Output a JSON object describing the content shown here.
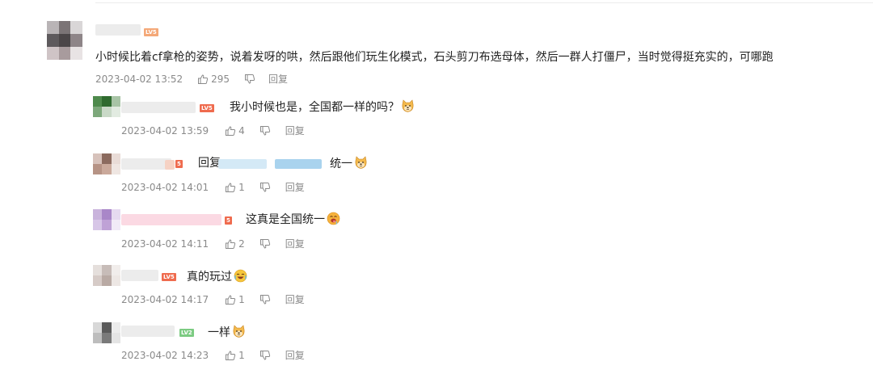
{
  "main_comment": {
    "level_badge": "LV5",
    "text": "小时候比着cf拿枪的姿势，说着发呀的哄，然后跟他们玩生化模式，石头剪刀布选母体，然后一群人打僵尸，当时觉得挺充实的，可哪跑",
    "timestamp": "2023-04-02 13:52",
    "likes": "295",
    "reply_label": "回复"
  },
  "replies": [
    {
      "level_badge": "LV5",
      "text": "我小时候也是，全国都一样的吗？",
      "emoji": "doge-emoji",
      "timestamp": "2023-04-02 13:59",
      "likes": "4",
      "reply_label": "回复"
    },
    {
      "level_badge": "5",
      "prefix": "回复",
      "text": "统一",
      "emoji": "doge-emoji",
      "timestamp": "2023-04-02 14:01",
      "likes": "1",
      "reply_label": "回复"
    },
    {
      "level_badge": "5",
      "text": "这真是全国统一",
      "emoji": "drool-emoji",
      "timestamp": "2023-04-02 14:11",
      "likes": "2",
      "reply_label": "回复"
    },
    {
      "level_badge": "LV5",
      "text": "真的玩过",
      "emoji": "laugh-cry-emoji",
      "timestamp": "2023-04-02 14:17",
      "likes": "1",
      "reply_label": "回复"
    },
    {
      "level_badge": "LV2",
      "text": "一样",
      "emoji": "doge-emoji",
      "timestamp": "2023-04-02 14:23",
      "likes": "1",
      "reply_label": "回复"
    }
  ],
  "colors": {
    "badge_orange": "#f59a70",
    "badge_red": "#ef6b4e",
    "badge_green": "#7ccb82",
    "meta_gray": "#8a8a8a"
  }
}
